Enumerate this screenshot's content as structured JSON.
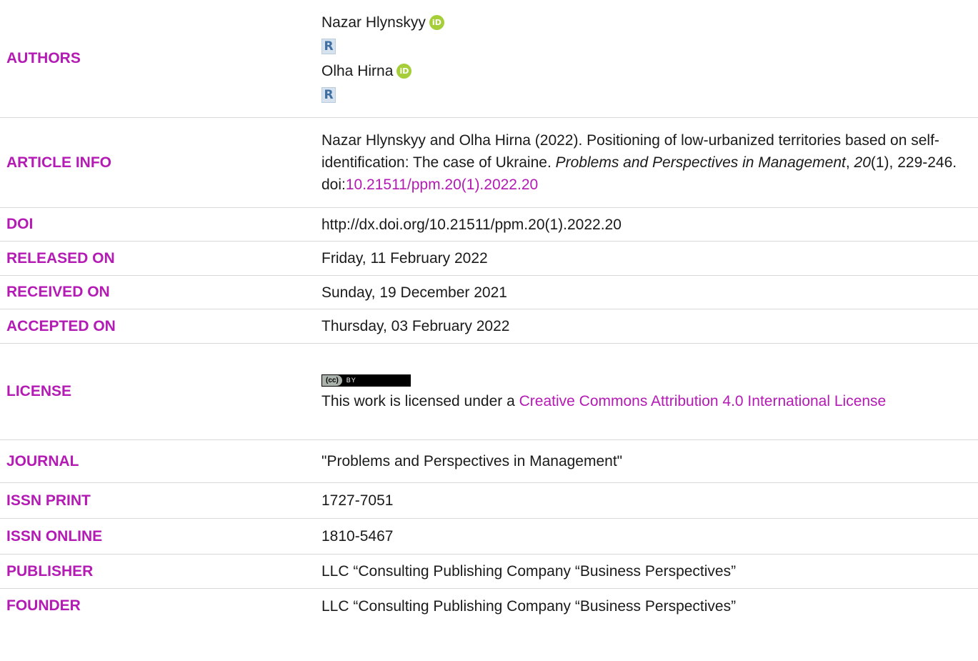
{
  "rows": {
    "authors": {
      "label": "AUTHORS",
      "author1": "Nazar Hlynskyy",
      "author2": "Olha Hirna",
      "orcid_text": "iD",
      "rg_text": "R"
    },
    "article_info": {
      "label": "ARTICLE INFO",
      "citation_main": "Nazar Hlynskyy and Olha Hirna (2022). Positioning of low-urbanized territories based on self-identification: The case of Ukraine. ",
      "journal_italic": "Problems and Perspectives in Management",
      "sep1": ", ",
      "volume_italic": "20",
      "issue_pages": "(1), 229-246. doi:",
      "doi_link": "10.21511/ppm.20(1).2022.20"
    },
    "doi": {
      "label": "DOI",
      "value": "http://dx.doi.org/10.21511/ppm.20(1).2022.20"
    },
    "released": {
      "label": "RELEASED ON",
      "value": "Friday, 11 February 2022"
    },
    "received": {
      "label": "RECEIVED ON",
      "value": "Sunday, 19 December 2021"
    },
    "accepted": {
      "label": "ACCEPTED ON",
      "value": "Thursday, 03 February 2022"
    },
    "license": {
      "label": "LICENSE",
      "badge_cc": "(cc)",
      "badge_by": "BY",
      "text": "This work is licensed under a ",
      "link": "Creative Commons Attribution 4.0 International License"
    },
    "journal": {
      "label": "JOURNAL",
      "value": "\"Problems and Perspectives in Management\""
    },
    "issn_print": {
      "label": "ISSN PRINT",
      "value": "1727-7051"
    },
    "issn_online": {
      "label": "ISSN ONLINE",
      "value": "1810-5467"
    },
    "publisher": {
      "label": "PUBLISHER",
      "value": "LLC “Consulting Publishing Company “Business Perspectives”"
    },
    "founder": {
      "label": "FOUNDER",
      "value": "LLC “Consulting Publishing Company “Business Perspectives”"
    }
  },
  "colors": {
    "label": "#b41ab4",
    "link": "#b41ab4",
    "orcid": "#a6ce39",
    "divider": "#d9d9d9"
  }
}
